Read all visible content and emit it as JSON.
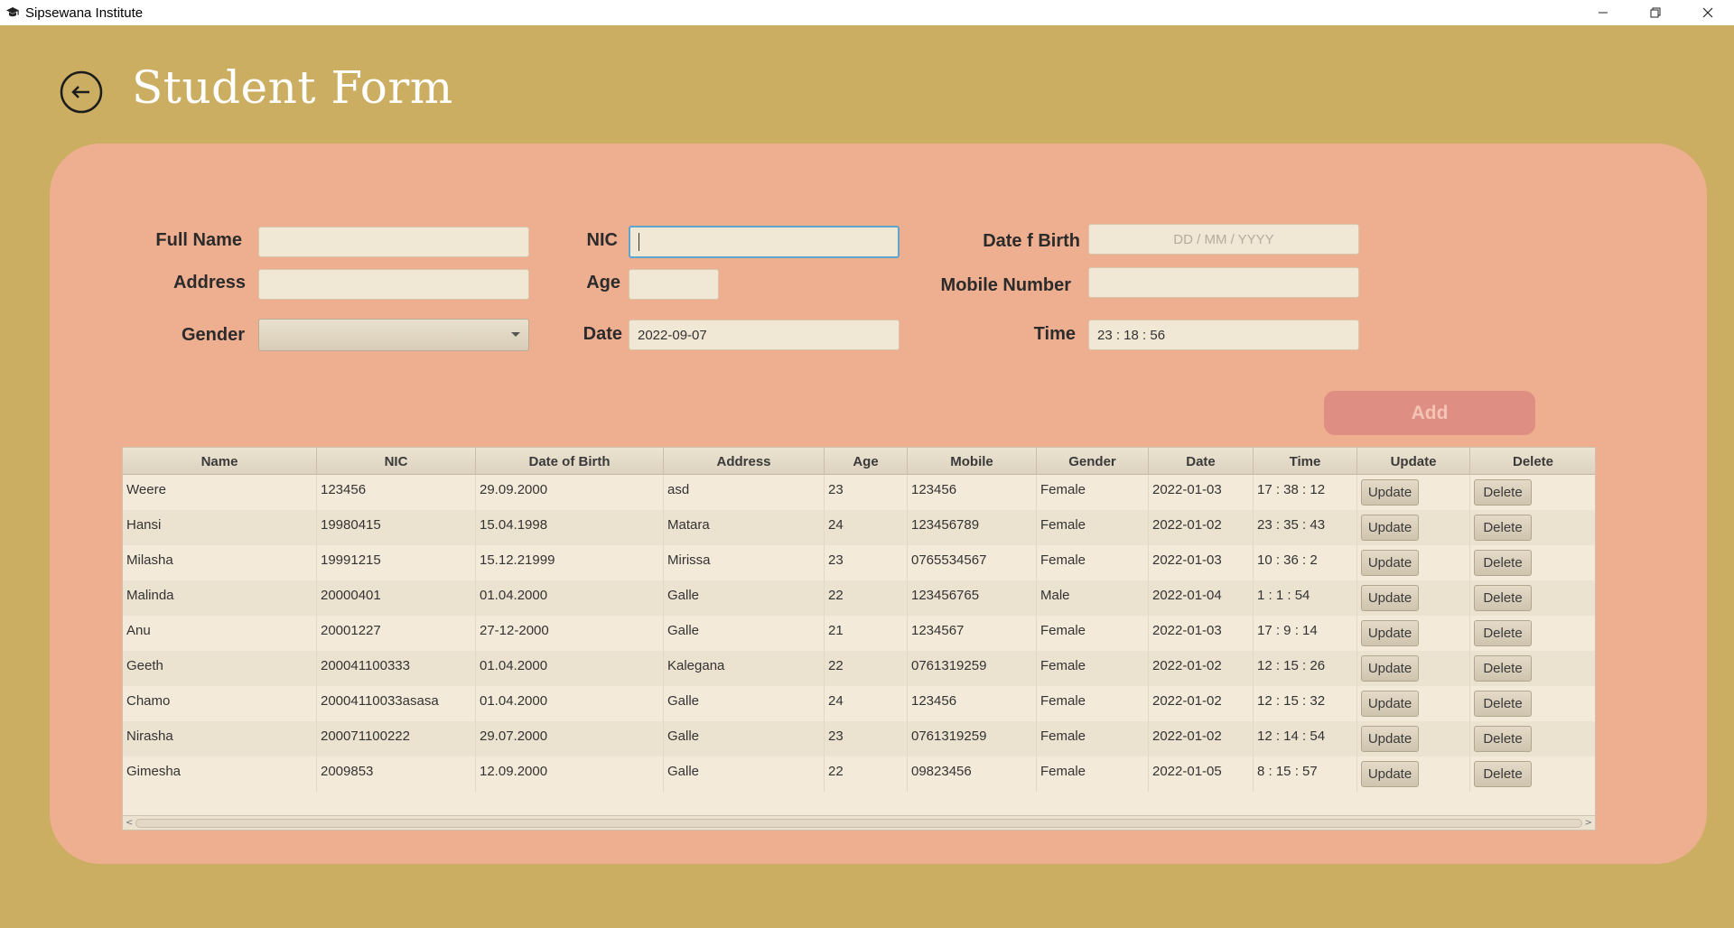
{
  "window": {
    "title": "Sipsewana Institute",
    "controls": [
      "minimize",
      "restore",
      "close"
    ]
  },
  "header": {
    "title": "Student Form",
    "back_icon": "arrow-left-circle-icon"
  },
  "form": {
    "full_name": {
      "label": "Full Name",
      "value": ""
    },
    "nic": {
      "label": "NIC",
      "value": ""
    },
    "dob": {
      "label": "Date f Birth",
      "placeholder": "DD / MM / YYYY"
    },
    "address": {
      "label": "Address",
      "value": ""
    },
    "age": {
      "label": "Age",
      "value": ""
    },
    "mobile": {
      "label": "Mobile Number",
      "value": ""
    },
    "gender": {
      "label": "Gender",
      "value": ""
    },
    "date": {
      "label": "Date",
      "value": "2022-09-07"
    },
    "time": {
      "label": "Time",
      "value": "23 : 18 : 56"
    },
    "add_label": "Add"
  },
  "table": {
    "columns": [
      "Name",
      "NIC",
      "Date of Birth",
      "Address",
      "Age",
      "Mobile",
      "Gender",
      "Date",
      "Time",
      "Update",
      "Delete"
    ],
    "rows": [
      [
        "Weere",
        "123456",
        "29.09.2000",
        "asd",
        "23",
        "123456",
        "Female",
        "2022-01-03",
        "17 : 38 : 12",
        "Update",
        "Delete"
      ],
      [
        "Hansi",
        "19980415",
        "15.04.1998",
        "Matara",
        "24",
        "123456789",
        "Female",
        "2022-01-02",
        "23 : 35 : 43",
        "Update",
        "Delete"
      ],
      [
        "Milasha",
        "19991215",
        "15.12.21999",
        "Mirissa",
        "23",
        "0765534567",
        "Female",
        "2022-01-03",
        "10 : 36 : 2",
        "Update",
        "Delete"
      ],
      [
        "Malinda",
        "20000401",
        "01.04.2000",
        "Galle",
        "22",
        "123456765",
        "Male",
        "2022-01-04",
        "1 : 1 : 54",
        "Update",
        "Delete"
      ],
      [
        "Anu",
        "20001227",
        "27-12-2000",
        "Galle",
        "21",
        "1234567",
        "Female",
        "2022-01-03",
        "17 : 9 : 14",
        "Update",
        "Delete"
      ],
      [
        "Geeth",
        "200041100333",
        "01.04.2000",
        "Kalegana",
        "22",
        "0761319259",
        "Female",
        "2022-01-02",
        "12 : 15 : 26",
        "Update",
        "Delete"
      ],
      [
        "Chamo",
        "20004110033asasa",
        "01.04.2000",
        "Galle",
        "24",
        "123456",
        "Female",
        "2022-01-02",
        "12 : 15 : 32",
        "Update",
        "Delete"
      ],
      [
        "Nirasha",
        "200071100222",
        "29.07.2000",
        "Galle",
        "23",
        "0761319259",
        "Female",
        "2022-01-02",
        "12 : 14 : 54",
        "Update",
        "Delete"
      ],
      [
        "Gimesha",
        "2009853",
        "12.09.2000",
        "Galle",
        "22",
        "09823456",
        "Female",
        "2022-01-05",
        "8 : 15 : 57",
        "Update",
        "Delete"
      ]
    ]
  },
  "colors": {
    "background": "#cbae62",
    "panel": "#eeae90",
    "field": "#f1e7d5",
    "add_button": "#df8e84",
    "focus": "#5fa6cf"
  }
}
